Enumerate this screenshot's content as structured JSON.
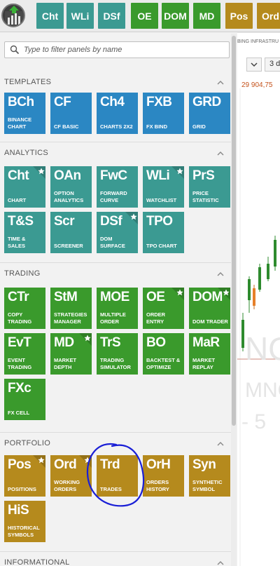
{
  "toolbar": {
    "buttons": [
      {
        "label": "Cht",
        "color": "#3b9a92"
      },
      {
        "label": "WLi",
        "color": "#3b9a92"
      },
      {
        "label": "DSf",
        "color": "#3b9a92"
      },
      {
        "label": "OE",
        "color": "#3a9a2c"
      },
      {
        "label": "DOM",
        "color": "#3a9a2c"
      },
      {
        "label": "MD",
        "color": "#3a9a2c"
      },
      {
        "label": "Pos",
        "color": "#b58a1d"
      },
      {
        "label": "Ord",
        "color": "#b58a1d"
      }
    ]
  },
  "search": {
    "placeholder": "Type to filter panels by name"
  },
  "sections": [
    {
      "title": "TEMPLATES",
      "tiles": [
        {
          "abbr": "BCh",
          "label": "BINANCE CHART",
          "color": "blue",
          "star": false
        },
        {
          "abbr": "CF",
          "label": "CF BASIC",
          "color": "blue",
          "star": false
        },
        {
          "abbr": "Ch4",
          "label": "CHARTS 2X2",
          "color": "blue",
          "star": false
        },
        {
          "abbr": "FXB",
          "label": "FX BIND",
          "color": "blue",
          "star": false
        },
        {
          "abbr": "GRD",
          "label": "GRID",
          "color": "blue",
          "star": false
        }
      ]
    },
    {
      "title": "ANALYTICS",
      "tiles": [
        {
          "abbr": "Cht",
          "label": "CHART",
          "color": "teal",
          "star": true
        },
        {
          "abbr": "OAn",
          "label": "OPTION ANALYTICS",
          "color": "teal",
          "star": false
        },
        {
          "abbr": "FwC",
          "label": "FORWARD CURVE",
          "color": "teal",
          "star": false
        },
        {
          "abbr": "WLi",
          "label": "WATCHLIST",
          "color": "teal",
          "star": true
        },
        {
          "abbr": "PrS",
          "label": "PRICE STATISTIC",
          "color": "teal",
          "star": false
        },
        {
          "abbr": "T&S",
          "label": "TIME & SALES",
          "color": "teal",
          "star": false
        },
        {
          "abbr": "Scr",
          "label": "SCREENER",
          "color": "teal",
          "star": false
        },
        {
          "abbr": "DSf",
          "label": "DOM SURFACE",
          "color": "teal",
          "star": true
        },
        {
          "abbr": "TPO",
          "label": "TPO CHART",
          "color": "teal",
          "star": false
        }
      ]
    },
    {
      "title": "TRADING",
      "tiles": [
        {
          "abbr": "CTr",
          "label": "COPY TRADING",
          "color": "green",
          "star": false
        },
        {
          "abbr": "StM",
          "label": "STRATEGIES MANAGER",
          "color": "green",
          "star": false
        },
        {
          "abbr": "MOE",
          "label": "MULTIPLE ORDER",
          "color": "green",
          "star": false
        },
        {
          "abbr": "OE",
          "label": "ORDER ENTRY",
          "color": "green",
          "star": true
        },
        {
          "abbr": "DOM",
          "label": "DOM TRADER",
          "color": "green",
          "star": true
        },
        {
          "abbr": "EvT",
          "label": "EVENT TRADING",
          "color": "green",
          "star": false
        },
        {
          "abbr": "MD",
          "label": "MARKET DEPTH",
          "color": "green",
          "star": true
        },
        {
          "abbr": "TrS",
          "label": "TRADING SIMULATOR",
          "color": "green",
          "star": false
        },
        {
          "abbr": "BO",
          "label": "BACKTEST & OPTIMIZE",
          "color": "green",
          "star": false
        },
        {
          "abbr": "MaR",
          "label": "MARKET REPLAY",
          "color": "green",
          "star": false
        },
        {
          "abbr": "FXc",
          "label": "FX CELL",
          "color": "green",
          "star": false
        }
      ]
    },
    {
      "title": "PORTFOLIO",
      "tiles": [
        {
          "abbr": "Pos",
          "label": "POSITIONS",
          "color": "gold",
          "star": true
        },
        {
          "abbr": "Ord",
          "label": "WORKING ORDERS",
          "color": "gold",
          "star": true
        },
        {
          "abbr": "Trd",
          "label": "TRADES",
          "color": "gold",
          "star": false
        },
        {
          "abbr": "OrH",
          "label": "ORDERS HISTORY",
          "color": "gold",
          "star": false
        },
        {
          "abbr": "Syn",
          "label": "SYNTHETIC SYMBOL",
          "color": "gold",
          "star": false
        },
        {
          "abbr": "HiS",
          "label": "HISTORICAL SYMBOLS",
          "color": "gold",
          "star": false
        }
      ]
    },
    {
      "title": "INFORMATIONAL",
      "tiles": []
    }
  ],
  "chart": {
    "header": "BING INFRASTRU",
    "control_2": "3 d",
    "price": "29 904,75",
    "watermark_1": "NQ",
    "watermark_2": "MNQ",
    "watermark_3": "- 5"
  }
}
